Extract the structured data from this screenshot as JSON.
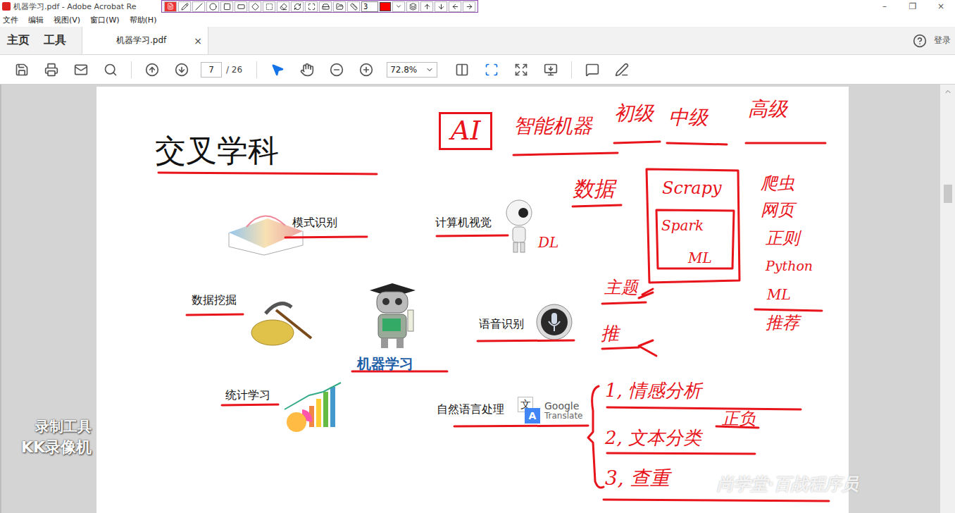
{
  "window": {
    "title": "机器学习.pdf - Adobe Acrobat Re",
    "controls": [
      "–",
      "❐",
      "×"
    ]
  },
  "annotation_toolbar": {
    "width_value": "3",
    "pen_color": "#ff0000"
  },
  "menu": [
    "文件",
    "编辑",
    "视图(V)",
    "窗口(W)",
    "帮助(H)"
  ],
  "nav_tabs": [
    {
      "label": "主页",
      "selected": false
    },
    {
      "label": "工具",
      "selected": false
    }
  ],
  "document_tab": {
    "label": "机器学习.pdf",
    "close": "×",
    "selected": true
  },
  "account": {
    "label": "登录"
  },
  "toolbar": {
    "page": "7",
    "total": "/ 26",
    "zoom": "72.8%",
    "tools": [
      {
        "kind": "select",
        "selected": true
      },
      {
        "kind": "hand",
        "selected": false
      }
    ]
  },
  "slide": {
    "title": "交叉学科",
    "center": {
      "label": "机器学习"
    },
    "fields": [
      {
        "label": "模式识别"
      },
      {
        "label": "计算机视觉"
      },
      {
        "label": "数据挖掘"
      },
      {
        "label": "语音识别"
      },
      {
        "label": "统计学习"
      },
      {
        "label": "自然语言处理"
      }
    ],
    "logo": {
      "glyph": "文",
      "letter": "A",
      "name": "Google",
      "product": "Translate"
    }
  },
  "annotations": [
    {
      "text": "AI",
      "boxed": true
    },
    {
      "text": "智能机器",
      "boxed": false
    },
    {
      "text": "初级",
      "boxed": false
    },
    {
      "text": "中级",
      "boxed": false
    },
    {
      "text": "高级",
      "boxed": false
    },
    {
      "text": "数据",
      "boxed": false
    },
    {
      "text": "Scrapy",
      "boxed": false
    },
    {
      "text": "Spark",
      "boxed": false
    },
    {
      "text": "ML",
      "boxed": false
    },
    {
      "text": "DL",
      "boxed": false
    },
    {
      "text": "爬虫",
      "boxed": false
    },
    {
      "text": "网页",
      "boxed": false
    },
    {
      "text": "正则",
      "boxed": false
    },
    {
      "text": "Python",
      "boxed": false
    },
    {
      "text": "ML",
      "boxed": false
    },
    {
      "text": "推荐",
      "boxed": false
    },
    {
      "text": "主题",
      "boxed": false
    },
    {
      "text": "推",
      "boxed": false
    },
    {
      "text": "1, 情感分析",
      "boxed": false
    },
    {
      "text": "正负",
      "boxed": false
    },
    {
      "text": "2, 文本分类",
      "boxed": false
    },
    {
      "text": "3, 查重",
      "boxed": false
    }
  ],
  "watermarks": {
    "recorder": [
      "录制工具",
      "KK录像机"
    ],
    "brand": "尚学堂·百战程序员"
  }
}
